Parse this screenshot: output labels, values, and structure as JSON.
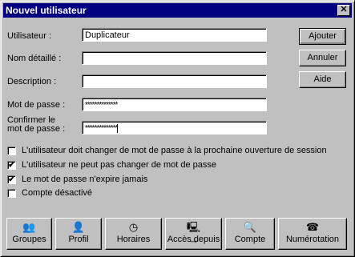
{
  "window": {
    "title": "Nouvel utilisateur",
    "close_label": "✕"
  },
  "form": {
    "username_label": "Utilisateur :",
    "username_value": "Duplicateur",
    "fullname_label": "Nom détaillé :",
    "fullname_value": "",
    "description_label": "Description :",
    "description_value": "",
    "password_label": "Mot de passe :",
    "password_value": "**************",
    "confirm_label_line1": "Confirmer le",
    "confirm_label_line2": "mot de passe :",
    "confirm_value": "**************"
  },
  "side_buttons": {
    "add": "Ajouter",
    "cancel": "Annuler",
    "help": "Aide"
  },
  "checkboxes": [
    {
      "label": "L'utilisateur doit changer de mot de passe à la prochaine ouverture de session",
      "checked": false
    },
    {
      "label": "L'utilisateur ne peut pas changer de mot de passe",
      "checked": true
    },
    {
      "label": "Le mot de passe n'expire jamais",
      "checked": true
    },
    {
      "label": "Compte désactivé",
      "checked": false
    }
  ],
  "bottom_buttons": [
    {
      "label": "Groupes",
      "icon": "groups-icon"
    },
    {
      "label": "Profil",
      "icon": "profile-icon"
    },
    {
      "label": "Horaires",
      "icon": "clock-icon"
    },
    {
      "label": "Accès depuis",
      "icon": "workstations-icon"
    },
    {
      "label": "Compte",
      "icon": "account-icon"
    },
    {
      "label": "Numérotation",
      "icon": "dialin-icon"
    }
  ]
}
